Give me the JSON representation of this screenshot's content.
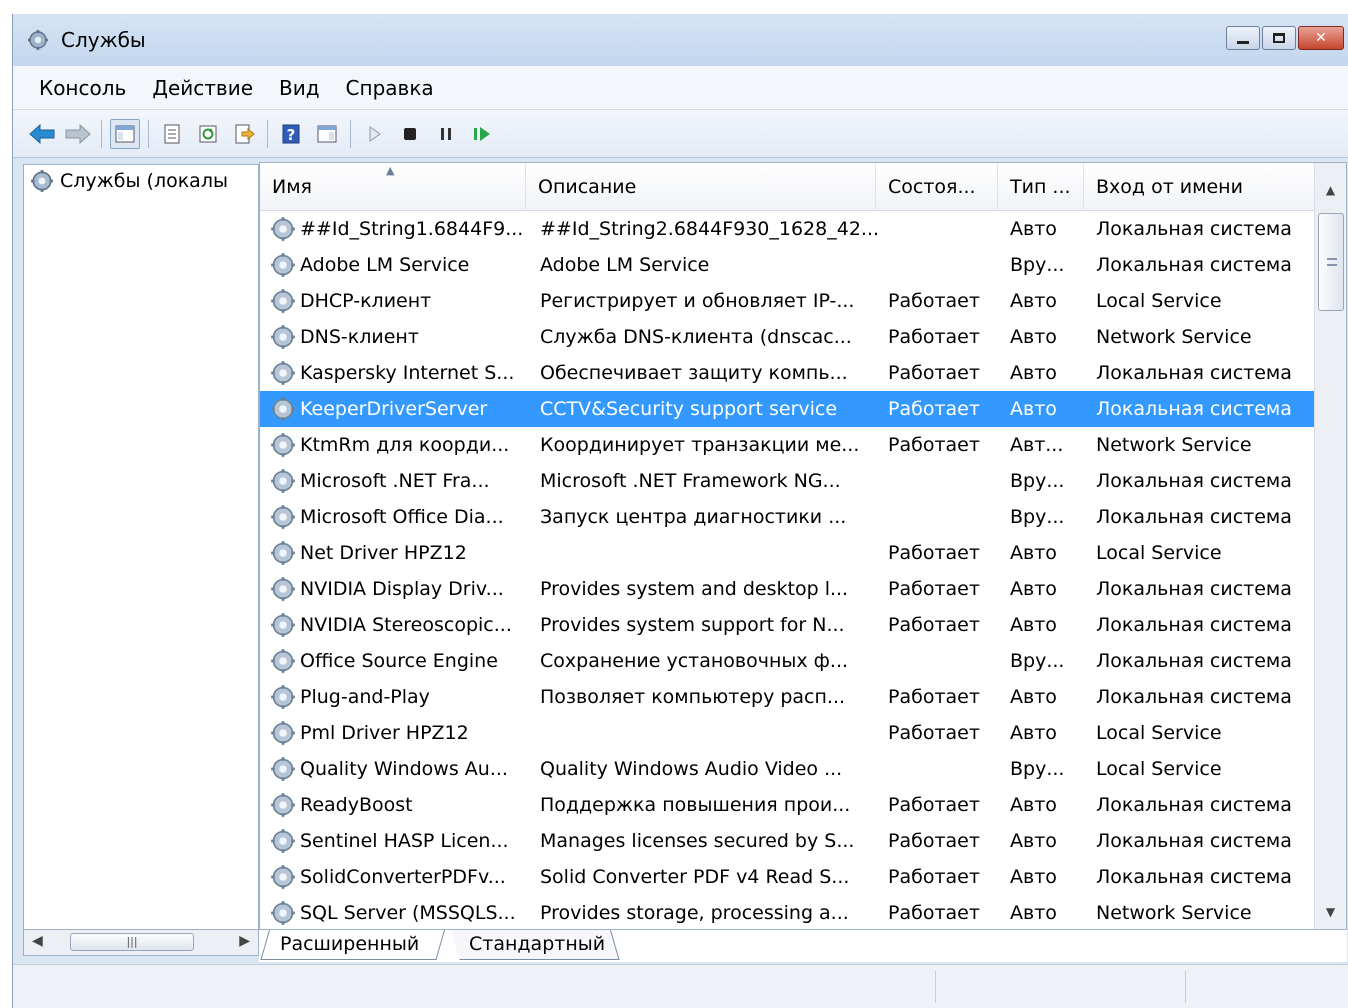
{
  "window": {
    "title": "Службы"
  },
  "menu": {
    "items": [
      "Консоль",
      "Действие",
      "Вид",
      "Справка"
    ]
  },
  "icons": {
    "back": "back-arrow-icon",
    "forward": "forward-arrow-icon",
    "accent": "#3399ff"
  },
  "tree": {
    "root_label": "Службы (локалы"
  },
  "columns": {
    "name": "Имя",
    "description": "Описание",
    "status": "Состоя...",
    "type": "Тип ...",
    "logon": "Вход от имени"
  },
  "rows": [
    {
      "name": "##Id_String1.6844F9...",
      "description": "##Id_String2.6844F930_1628_42...",
      "status": "",
      "type": "Авто",
      "logon": "Локальная система"
    },
    {
      "name": "Adobe LM Service",
      "description": "Adobe LM Service",
      "status": "",
      "type": "Вру...",
      "logon": "Локальная система"
    },
    {
      "name": "DHCP-клиент",
      "description": "Регистрирует и обновляет IP-...",
      "status": "Работает",
      "type": "Авто",
      "logon": "Local Service"
    },
    {
      "name": "DNS-клиент",
      "description": "Служба DNS-клиента (dnscac...",
      "status": "Работает",
      "type": "Авто",
      "logon": "Network Service"
    },
    {
      "name": "Kaspersky Internet S...",
      "description": "Обеспечивает защиту компь...",
      "status": "Работает",
      "type": "Авто",
      "logon": "Локальная система"
    },
    {
      "name": "KeeperDriverServer",
      "description": "CCTV&Security support service",
      "status": "Работает",
      "type": "Авто",
      "logon": "Локальная система",
      "selected": true
    },
    {
      "name": "KtmRm для коорди...",
      "description": "Координирует транзакции ме...",
      "status": "Работает",
      "type": "Авт...",
      "logon": "Network Service"
    },
    {
      "name": "Microsoft .NET Fra...",
      "description": "Microsoft .NET Framework NG...",
      "status": "",
      "type": "Вру...",
      "logon": "Локальная система"
    },
    {
      "name": "Microsoft Office Dia...",
      "description": "Запуск центра диагностики ...",
      "status": "",
      "type": "Вру...",
      "logon": "Локальная система"
    },
    {
      "name": "Net Driver HPZ12",
      "description": "",
      "status": "Работает",
      "type": "Авто",
      "logon": "Local Service"
    },
    {
      "name": "NVIDIA Display Driv...",
      "description": "Provides system and desktop l...",
      "status": "Работает",
      "type": "Авто",
      "logon": "Локальная система"
    },
    {
      "name": "NVIDIA Stereoscopic...",
      "description": "Provides system support for N...",
      "status": "Работает",
      "type": "Авто",
      "logon": "Локальная система"
    },
    {
      "name": "Office Source Engine",
      "description": "Сохранение установочных ф...",
      "status": "",
      "type": "Вру...",
      "logon": "Локальная система"
    },
    {
      "name": "Plug-and-Play",
      "description": "Позволяет компьютеру расп...",
      "status": "Работает",
      "type": "Авто",
      "logon": "Локальная система"
    },
    {
      "name": "Pml Driver HPZ12",
      "description": "",
      "status": "Работает",
      "type": "Авто",
      "logon": "Local Service"
    },
    {
      "name": "Quality Windows Au...",
      "description": "Quality Windows Audio Video ...",
      "status": "",
      "type": "Вру...",
      "logon": "Local Service"
    },
    {
      "name": "ReadyBoost",
      "description": "Поддержка повышения прои...",
      "status": "Работает",
      "type": "Авто",
      "logon": "Локальная система"
    },
    {
      "name": "Sentinel HASP Licen...",
      "description": "Manages licenses secured by S...",
      "status": "Работает",
      "type": "Авто",
      "logon": "Локальная система"
    },
    {
      "name": "SolidConverterPDFv...",
      "description": "Solid Converter PDF v4 Read S...",
      "status": "Работает",
      "type": "Авто",
      "logon": "Локальная система"
    },
    {
      "name": "SQL Server (MSSQLS...",
      "description": "Provides storage, processing a...",
      "status": "Работает",
      "type": "Авто",
      "logon": "Network Service"
    }
  ],
  "tabs": [
    "Расширенный",
    "Стандартный"
  ]
}
